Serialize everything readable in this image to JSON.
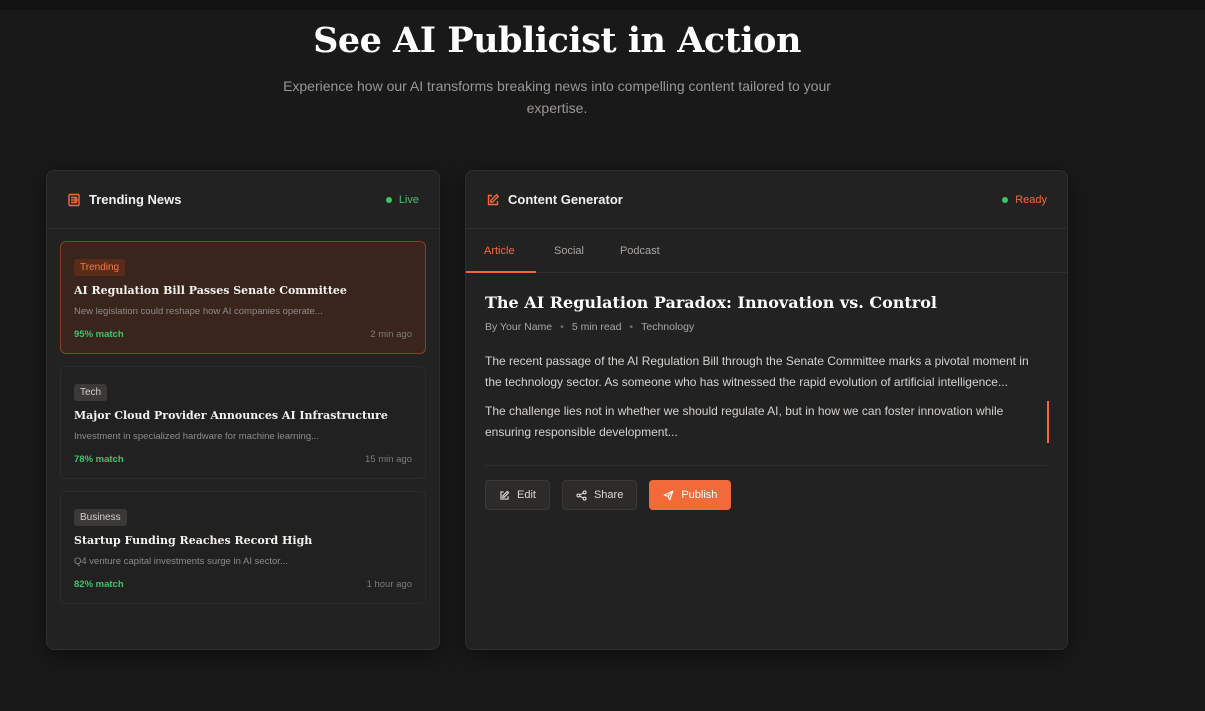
{
  "hero": {
    "title": "See AI Publicist in Action",
    "subtitle": "Experience how our AI transforms breaking news into compelling content tailored to your expertise."
  },
  "news_panel": {
    "title": "Trending News",
    "icon": "newspaper-icon",
    "status": "Live",
    "items": [
      {
        "tag": "Trending",
        "title": "AI Regulation Bill Passes Senate Committee",
        "desc": "New legislation could reshape how AI companies operate...",
        "match": "95% match",
        "time": "2 min ago"
      },
      {
        "tag": "Tech",
        "title": "Major Cloud Provider Announces AI Infrastructure",
        "desc": "Investment in specialized hardware for machine learning...",
        "match": "78% match",
        "time": "15 min ago"
      },
      {
        "tag": "Business",
        "title": "Startup Funding Reaches Record High",
        "desc": "Q4 venture capital investments surge in AI sector...",
        "match": "82% match",
        "time": "1 hour ago"
      }
    ]
  },
  "generator_panel": {
    "title": "Content Generator",
    "icon": "edit-icon",
    "status": "Ready",
    "tabs": [
      "Article",
      "Social",
      "Podcast"
    ],
    "article": {
      "title": "The AI Regulation Paradox: Innovation vs. Control",
      "author": "By Your Name",
      "read_time": "5 min read",
      "category": "Technology",
      "paragraph1": "The recent passage of the AI Regulation Bill through the Senate Committee marks a pivotal moment in the technology sector. As someone who has witnessed the rapid evolution of artificial intelligence...",
      "paragraph2": "The challenge lies not in whether we should regulate AI, but in how we can foster innovation while ensuring responsible development..."
    },
    "actions": {
      "edit": "Edit",
      "share": "Share",
      "publish": "Publish"
    }
  },
  "colors": {
    "accent": "#f26a3a",
    "live": "#3ec46d",
    "background": "#1a1919"
  }
}
